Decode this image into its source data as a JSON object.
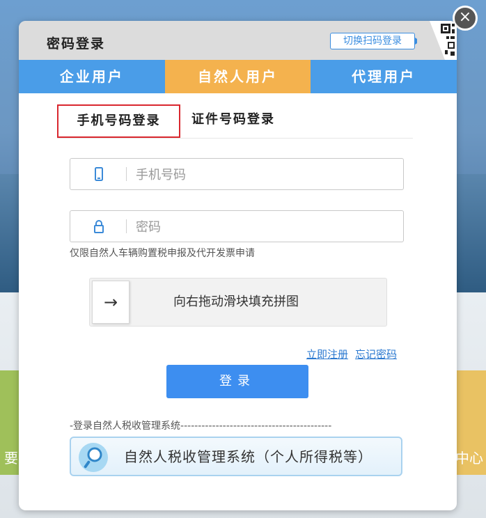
{
  "background": {
    "left_tile_text": "要",
    "right_tile_text": "中心"
  },
  "close_button": {
    "symbol": "×",
    "icon": "close-icon"
  },
  "dialog": {
    "title": "密码登录",
    "switch_button": "切换扫码登录",
    "user_tabs": [
      {
        "label": "企业用户",
        "active": false
      },
      {
        "label": "自然人用户",
        "active": true
      },
      {
        "label": "代理用户",
        "active": false
      }
    ],
    "login_tabs": [
      {
        "label": "手机号码登录",
        "active": true
      },
      {
        "label": "证件号码登录",
        "active": false
      }
    ],
    "phone_field": {
      "placeholder": "手机号码",
      "value": "",
      "icon": "mobile-phone-icon"
    },
    "password_field": {
      "placeholder": "密码",
      "value": "",
      "icon": "lock-icon"
    },
    "hint": "仅限自然人车辆购置税申报及代开发票申请",
    "slider": {
      "handle_symbol": "→",
      "text": "向右拖动滑块填充拼图"
    },
    "links": {
      "register": "立即注册",
      "forgot": "忘记密码"
    },
    "login_button": "登录",
    "divider_text": "-登录自然人税收管理系统-------------------------------------------",
    "system_button": {
      "text": "自然人税收管理系统（个人所得税等）",
      "icon": "magnifier-icon"
    }
  },
  "colors": {
    "tab_blue": "#4a9de8",
    "tab_orange": "#f4b24e",
    "login_button": "#3d8ef0",
    "active_tab_border": "#d9272e",
    "link": "#2a78d0"
  }
}
